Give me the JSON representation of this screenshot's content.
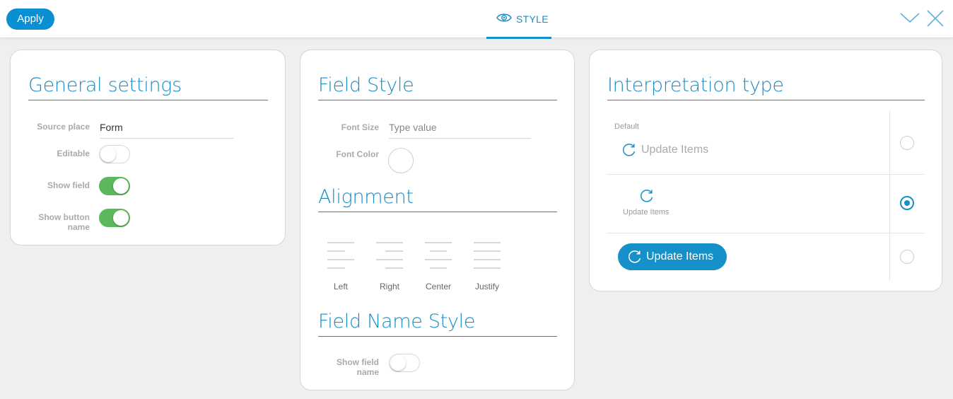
{
  "toolbar": {
    "apply_label": "Apply",
    "tab_label": "STYLE",
    "icons": {
      "tab": "eye-icon",
      "collapse": "chevron-down-icon",
      "close": "close-icon"
    }
  },
  "general": {
    "title": "General settings",
    "source_place_label": "Source place",
    "source_place_value": "Form",
    "editable_label": "Editable",
    "editable": false,
    "show_field_label": "Show field",
    "show_field": true,
    "show_button_name_label": "Show button name",
    "show_button_name": true
  },
  "field_style": {
    "title": "Field Style",
    "font_size_label": "Font Size",
    "font_size_placeholder": "Type value",
    "font_color_label": "Font Color",
    "alignment_title": "Alignment",
    "alignments": [
      "Left",
      "Right",
      "Center",
      "Justify"
    ],
    "field_name_style_title": "Field Name Style",
    "show_field_name_label": "Show field name",
    "show_field_name": false
  },
  "interpretation": {
    "title": "Interpretation type",
    "default_label": "Default",
    "options": [
      {
        "label": "Update Items",
        "style": "inline-icon",
        "selected": false
      },
      {
        "label": "Update Items",
        "style": "stacked-icon",
        "selected": true
      },
      {
        "label": "Update Items",
        "style": "button",
        "selected": false
      }
    ],
    "icon": "refresh-icon"
  },
  "colors": {
    "accent": "#1690c9",
    "apply_button": "#0b8fd3",
    "toggle_on": "#5cb85c",
    "background": "#eeeff1"
  }
}
